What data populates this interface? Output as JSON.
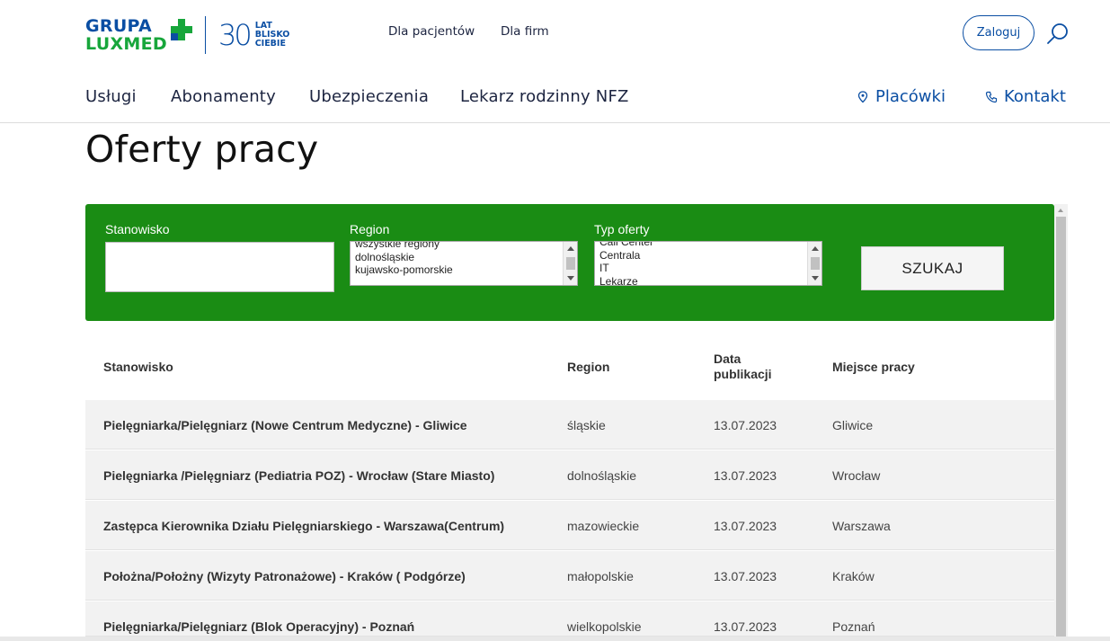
{
  "header": {
    "logo": {
      "line1": "GRUPA",
      "line2": "LUXMED",
      "anniv_number": "30",
      "anniv_line1": "LAT",
      "anniv_line2": "BLISKO",
      "anniv_line3": "CIEBIE"
    },
    "top_links": [
      "Dla pacjentów",
      "Dla firm"
    ],
    "login_label": "Zaloguj",
    "nav": [
      "Usługi",
      "Abonamenty",
      "Ubezpieczenia",
      "Lekarz rodzinny NFZ"
    ],
    "nav_right": {
      "placowki": "Placówki",
      "kontakt": "Kontakt"
    }
  },
  "page_title": "Oferty pracy",
  "search": {
    "position_label": "Stanowisko",
    "position_value": "",
    "region_label": "Region",
    "region_options": [
      "wszystkie regiony",
      "dolnośląskie",
      "kujawsko-pomorskie"
    ],
    "type_label": "Typ oferty",
    "type_options": [
      "Call Center",
      "Centrala",
      "IT",
      "Lekarze"
    ],
    "submit_label": "SZUKAJ"
  },
  "table": {
    "headers": {
      "position": "Stanowisko",
      "region": "Region",
      "date_line1": "Data",
      "date_line2": "publikacji",
      "place": "Miejsce pracy"
    },
    "rows": [
      {
        "position": "Pielęgniarka/Pielęgniarz (Nowe Centrum Medyczne) - Gliwice",
        "region": "śląskie",
        "date": "13.07.2023",
        "place": "Gliwice"
      },
      {
        "position": "Pielęgniarka /Pielęgniarz (Pediatria POZ) - Wrocław (Stare Miasto)",
        "region": "dolnośląskie",
        "date": "13.07.2023",
        "place": "Wrocław"
      },
      {
        "position": "Zastępca Kierownika Działu Pielęgniarskiego - Warszawa(Centrum)",
        "region": "mazowieckie",
        "date": "13.07.2023",
        "place": "Warszawa"
      },
      {
        "position": "Położna/Położny (Wizyty Patronażowe) - Kraków ( Podgórze)",
        "region": "małopolskie",
        "date": "13.07.2023",
        "place": "Kraków"
      },
      {
        "position": "Pielęgniarka/Pielęgniarz (Blok Operacyjny) - Poznań",
        "region": "wielkopolskie",
        "date": "13.07.2023",
        "place": "Poznań"
      }
    ]
  },
  "colors": {
    "brand_blue": "#0a4ea3",
    "brand_green": "#17a63b",
    "panel_green": "#1a8c14"
  }
}
